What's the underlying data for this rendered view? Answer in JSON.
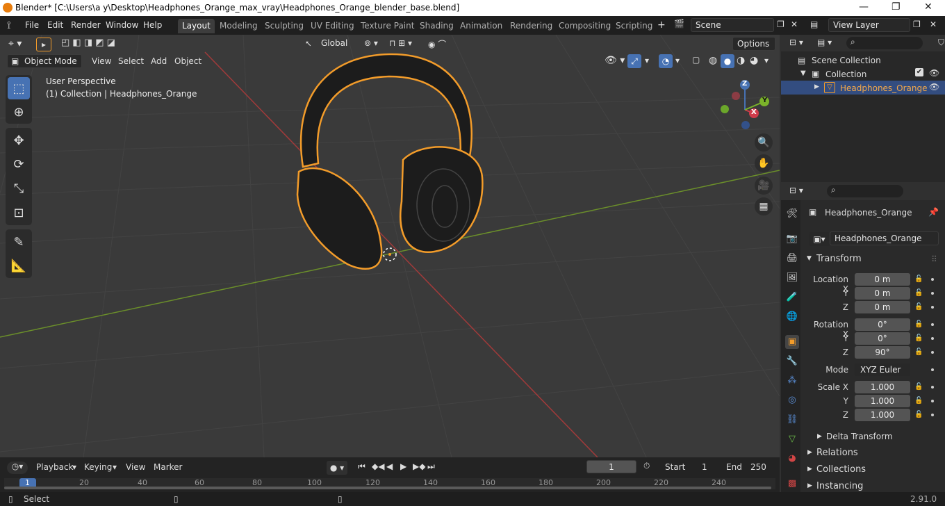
{
  "window": {
    "title": "Blender* [C:\\Users\\a y\\Desktop\\Headphones_Orange_max_vray\\Headphones_Orange_blender_base.blend]",
    "minimize": "—",
    "maximize": "❐",
    "close": "✕"
  },
  "menus": [
    "File",
    "Edit",
    "Render",
    "Window",
    "Help"
  ],
  "workspace_tabs": [
    {
      "label": "Layout",
      "active": true
    },
    {
      "label": "Modeling"
    },
    {
      "label": "Sculpting"
    },
    {
      "label": "UV Editing"
    },
    {
      "label": "Texture Paint"
    },
    {
      "label": "Shading"
    },
    {
      "label": "Animation"
    },
    {
      "label": "Rendering"
    },
    {
      "label": "Compositing"
    },
    {
      "label": "Scripting"
    }
  ],
  "scene": "Scene",
  "view_layer": "View Layer",
  "toolheader": {
    "orientation": "Global",
    "options": "Options"
  },
  "viewport_header": {
    "mode": "Object Mode",
    "view": "View",
    "select": "Select",
    "add": "Add",
    "object": "Object"
  },
  "overlay_text": {
    "perspective": "User Perspective",
    "collection": "(1) Collection | Headphones_Orange"
  },
  "gizmo": {
    "x": "X",
    "y": "Y",
    "z": "Z"
  },
  "outliner": {
    "root": "Scene Collection",
    "collection": "Collection",
    "object": "Headphones_Orange"
  },
  "properties": {
    "object_name": "Headphones_Orange",
    "data_name": "Headphones_Orange",
    "transform_label": "Transform",
    "location": {
      "label": "Location X",
      "x": "0 m",
      "y": "0 m",
      "z": "0 m"
    },
    "rotation": {
      "label": "Rotation X",
      "x": "0°",
      "y": "0°",
      "z": "90°"
    },
    "mode_label": "Mode",
    "mode": "XYZ Euler",
    "scale": {
      "label": "Scale X",
      "x": "1.000",
      "y": "1.000",
      "z": "1.000"
    },
    "axis_y": "Y",
    "axis_z": "Z",
    "delta": "Delta Transform",
    "relations": "Relations",
    "collections": "Collections",
    "instancing": "Instancing"
  },
  "timeline": {
    "playback": "Playback",
    "keying": "Keying",
    "view": "View",
    "marker": "Marker",
    "current_frame": "1",
    "start_label": "Start",
    "start": "1",
    "end_label": "End",
    "end": "250",
    "ticks": [
      "1",
      "20",
      "40",
      "60",
      "80",
      "100",
      "120",
      "140",
      "160",
      "180",
      "200",
      "220",
      "240"
    ]
  },
  "status": {
    "select": "Select",
    "version": "2.91.0"
  },
  "colors": {
    "accent": "#4772b3",
    "selection": "#f39c2a"
  }
}
